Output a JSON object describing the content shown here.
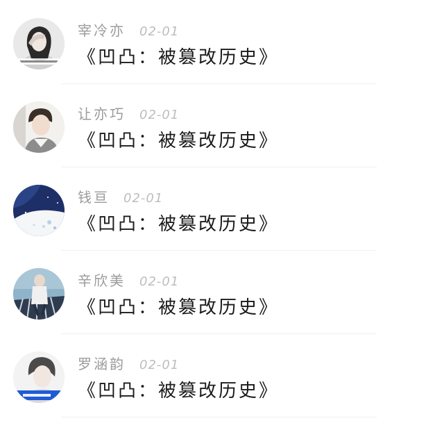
{
  "items": [
    {
      "name": "宰冷亦",
      "date": "02-01",
      "title": "《凹凸：被篡改历史》",
      "avatar": "avatar-girl-hand-icon"
    },
    {
      "name": "让亦巧",
      "date": "02-01",
      "title": "《凹凸：被篡改历史》",
      "avatar": "avatar-boy-icon"
    },
    {
      "name": "钱亘",
      "date": "02-01",
      "title": "《凹凸：被篡改历史》",
      "avatar": "avatar-night-sky-icon"
    },
    {
      "name": "辛欣美",
      "date": "02-01",
      "title": "《凹凸：被篡改历史》",
      "avatar": "avatar-couple-icon"
    },
    {
      "name": "罗涵韵",
      "date": "02-01",
      "title": "《凹凸：被篡改历史》",
      "avatar": "avatar-portrait-icon"
    }
  ],
  "colors": {
    "name": "#9b9b9b",
    "date": "#bdbdbd",
    "title": "#1a1a1a",
    "divider": "#f0f0f0",
    "background": "#ffffff"
  }
}
